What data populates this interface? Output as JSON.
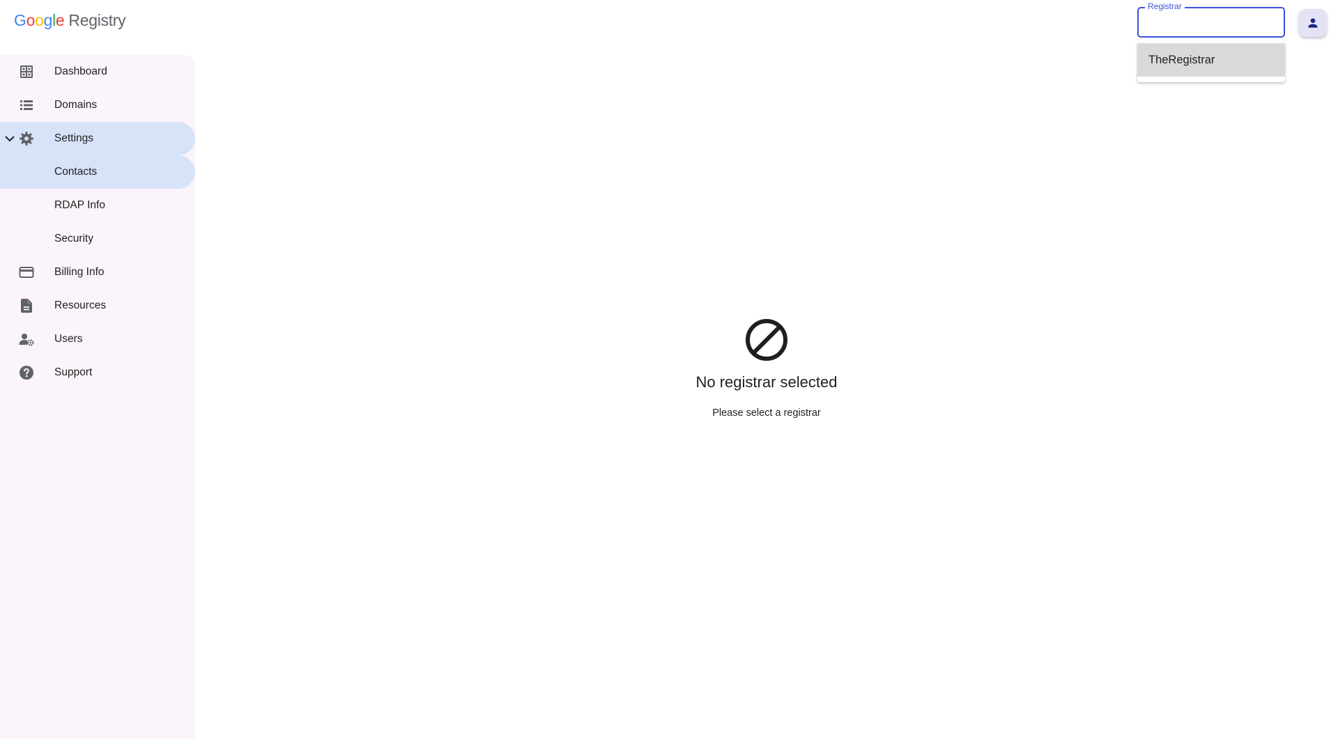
{
  "header": {
    "logo_letters": [
      "G",
      "o",
      "o",
      "g",
      "l",
      "e"
    ],
    "product_name": "Registry"
  },
  "sidebar": {
    "items": [
      {
        "label": "Dashboard",
        "icon": "dashboard-icon"
      },
      {
        "label": "Domains",
        "icon": "list-icon"
      },
      {
        "label": "Settings",
        "icon": "gear-icon",
        "expanded": true
      },
      {
        "label": "Contacts",
        "selected": true
      },
      {
        "label": "RDAP Info"
      },
      {
        "label": "Security"
      },
      {
        "label": "Billing Info",
        "icon": "credit-card-icon"
      },
      {
        "label": "Resources",
        "icon": "document-icon"
      },
      {
        "label": "Users",
        "icon": "manage-accounts-icon"
      },
      {
        "label": "Support",
        "icon": "help-icon"
      }
    ]
  },
  "registrar_select": {
    "label": "Registrar",
    "value": "",
    "options": [
      "TheRegistrar"
    ]
  },
  "account": {
    "icon": "person-icon"
  },
  "empty_state": {
    "icon": "block-icon",
    "title": "No registrar selected",
    "message": "Please select a registrar"
  },
  "colors": {
    "sidebar_bg": "#fcf4fb",
    "active_bg": "#d7e3f8",
    "accent": "#3b51d6",
    "option_hover": "#d9d9d9",
    "icon_gray": "#5f6368"
  }
}
